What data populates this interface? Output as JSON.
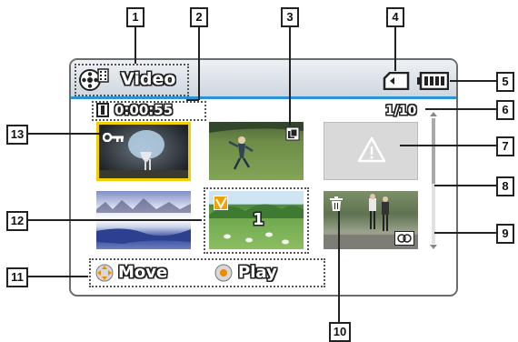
{
  "header": {
    "mode_label": "Video",
    "mode_icon": "video-mode-icon",
    "memory_icon": "memory-card-icon",
    "battery_icon": "battery-icon"
  },
  "info": {
    "duration": "0:00:55",
    "file_counter": "1/10"
  },
  "thumbnails": [
    {
      "name": "thumb-umbrella-girl",
      "badge": "protect-key-icon",
      "selected": true
    },
    {
      "name": "thumb-field-players",
      "badge": "copy-icon"
    },
    {
      "name": "thumb-damaged-file",
      "badge": "warning-icon"
    },
    {
      "name": "thumb-winter-river"
    },
    {
      "name": "thumb-meadow-sheep",
      "badge": "check-icon",
      "print_count": "1"
    },
    {
      "name": "thumb-skaters",
      "badge": "trash-icon",
      "corner_badge": "face-icon"
    }
  ],
  "footer": {
    "move_label": "Move",
    "play_label": "Play"
  },
  "callouts": [
    "1",
    "2",
    "3",
    "4",
    "5",
    "6",
    "7",
    "8",
    "9",
    "10",
    "11",
    "12",
    "13"
  ],
  "colors": {
    "accent_line": "#2a95d6",
    "selection_border": "#f2d000"
  }
}
